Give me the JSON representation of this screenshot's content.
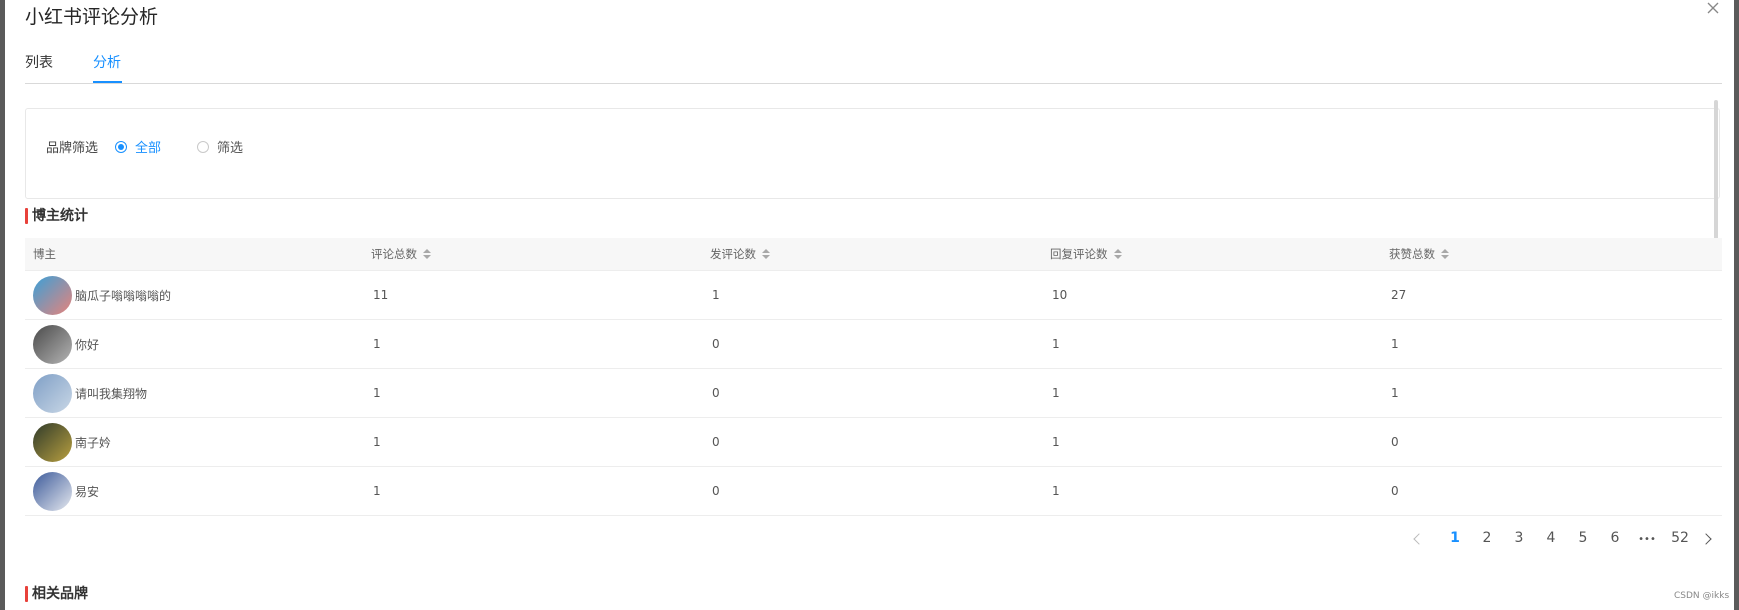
{
  "window": {
    "title": "小红书评论分析"
  },
  "tabs": [
    {
      "label": "列表",
      "active": false
    },
    {
      "label": "分析",
      "active": true
    }
  ],
  "filter": {
    "label": "品牌筛选",
    "options": [
      {
        "label": "全部",
        "checked": true
      },
      {
        "label": "筛选",
        "checked": false
      }
    ]
  },
  "blogger_section": {
    "title": "博主统计",
    "columns": [
      "博主",
      "评论总数",
      "发评论数",
      "回复评论数",
      "获赞总数"
    ],
    "rows": [
      {
        "name": "脑瓜子嗡嗡嗡嗡的",
        "total": "11",
        "posted": "1",
        "replies": "10",
        "likes": "27",
        "avatar_colors": [
          "#3aa0d8",
          "#e8837a"
        ]
      },
      {
        "name": "你好",
        "total": "1",
        "posted": "0",
        "replies": "1",
        "likes": "1",
        "avatar_colors": [
          "#4a4a4a",
          "#b5b5b5"
        ]
      },
      {
        "name": "请叫我集翔物",
        "total": "1",
        "posted": "0",
        "replies": "1",
        "likes": "1",
        "avatar_colors": [
          "#7f9fc6",
          "#c9d7e6"
        ]
      },
      {
        "name": "南子妗",
        "total": "1",
        "posted": "0",
        "replies": "1",
        "likes": "0",
        "avatar_colors": [
          "#2f3a2a",
          "#b9a040"
        ]
      },
      {
        "name": "易安",
        "total": "1",
        "posted": "0",
        "replies": "1",
        "likes": "0",
        "avatar_colors": [
          "#3c5a9a",
          "#e6e9ef"
        ]
      }
    ]
  },
  "pagination": {
    "pages": [
      "1",
      "2",
      "3",
      "4",
      "5",
      "6"
    ],
    "current": "1",
    "ellipsis": "•••",
    "last": "52"
  },
  "brand_section": {
    "title": "相关品牌"
  },
  "watermark": "CSDN @ikks",
  "colors": {
    "accent": "#1890ff",
    "section_marker": "#e8413b"
  }
}
